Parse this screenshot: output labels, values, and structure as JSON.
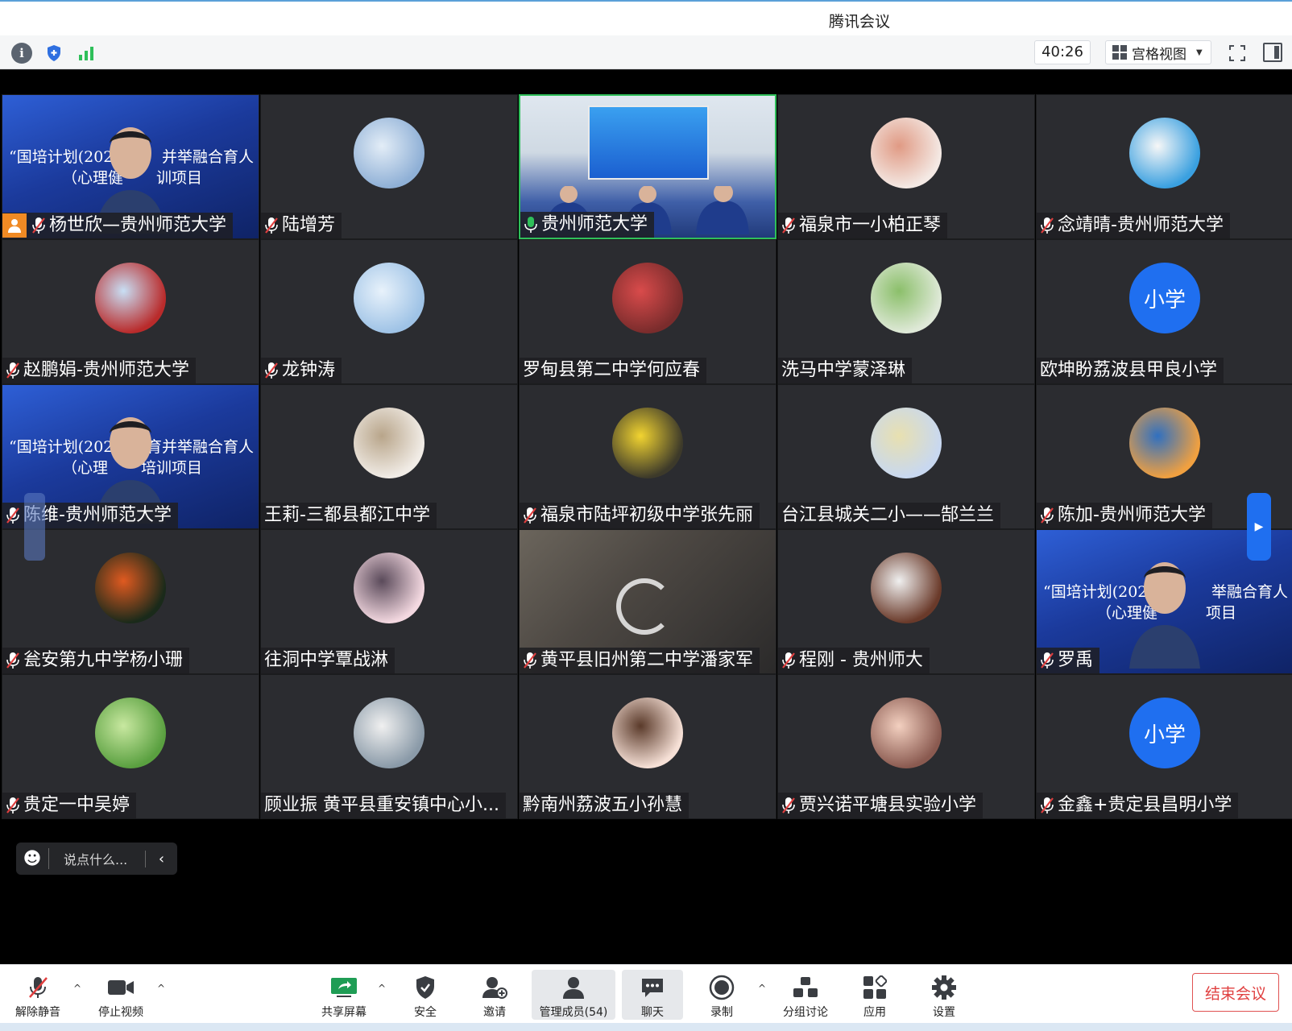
{
  "window": {
    "title": "腾讯会议"
  },
  "infobar": {
    "timer": "40:26",
    "view_label": "宫格视图"
  },
  "participants": [
    {
      "name": "杨世欣—贵州师范大学",
      "host": true,
      "muted": true,
      "kind": "video-blue",
      "slide_line1": "“国培计划(2022",
      "slide_line2": "（心理健",
      "slide_line1b": "并举融合育人",
      "slide_line2b": "训项目"
    },
    {
      "name": "陆增芳",
      "muted": true,
      "kind": "avatar"
    },
    {
      "name": "贵州师范大学",
      "muted": false,
      "speaking": true,
      "kind": "video-room",
      "active": true
    },
    {
      "name": "福泉市一小柏正琴",
      "muted": true,
      "kind": "avatar"
    },
    {
      "name": "念靖晴-贵州师范大学",
      "muted": true,
      "kind": "avatar"
    },
    {
      "name": "赵鹏娟-贵州师范大学",
      "muted": true,
      "kind": "avatar"
    },
    {
      "name": "龙钟涛",
      "muted": true,
      "kind": "avatar"
    },
    {
      "name": "罗甸县第二中学何应春",
      "muted": false,
      "kind": "avatar"
    },
    {
      "name": "洗马中学蒙泽琳",
      "muted": false,
      "kind": "avatar"
    },
    {
      "name": "欧坤盼荔波县甲良小学",
      "muted": false,
      "kind": "text-avatar",
      "avatar_text": "小学"
    },
    {
      "name": "陈维-贵州师范大学",
      "muted": true,
      "kind": "video-blue",
      "slide_line1": "“国培计划(202",
      "slide_line2": "（心理",
      "slide_line1b": "五育并举融合育人",
      "slide_line2b": "培训项目"
    },
    {
      "name": "王莉-三都县都江中学",
      "muted": false,
      "kind": "avatar"
    },
    {
      "name": "福泉市陆坪初级中学张先丽",
      "muted": true,
      "kind": "avatar"
    },
    {
      "name": "台江县城关二小——郜兰兰",
      "muted": false,
      "kind": "avatar"
    },
    {
      "name": "陈加-贵州师范大学",
      "muted": true,
      "kind": "avatar"
    },
    {
      "name": "瓮安第九中学杨小珊",
      "muted": true,
      "kind": "avatar"
    },
    {
      "name": "往洞中学覃战淋",
      "muted": false,
      "kind": "avatar"
    },
    {
      "name": "黄平县旧州第二中学潘家军",
      "muted": true,
      "kind": "video-dark"
    },
    {
      "name": "程刚 - 贵州师大",
      "muted": true,
      "kind": "avatar"
    },
    {
      "name": "罗禹",
      "muted": true,
      "kind": "video-blue",
      "slide_line1": "“国培计划(2022)",
      "slide_line2": "（心理健",
      "slide_line1b": "举融合育人",
      "slide_line2b": "项目"
    },
    {
      "name": "贵定一中吴婷",
      "muted": true,
      "kind": "avatar"
    },
    {
      "name": "顾业振  黄平县重安镇中心小...",
      "muted": false,
      "kind": "avatar"
    },
    {
      "name": "黔南州荔波五小孙慧",
      "muted": false,
      "kind": "avatar"
    },
    {
      "name": "贾兴诺平塘县实验小学",
      "muted": true,
      "kind": "avatar"
    },
    {
      "name": "金鑫+贵定县昌明小学",
      "muted": true,
      "kind": "text-avatar",
      "avatar_text": "小学"
    }
  ],
  "quick_chat": {
    "placeholder": "说点什么..."
  },
  "toolbar": {
    "unmute": "解除静音",
    "stop_video": "停止视频",
    "share_screen": "共享屏幕",
    "security": "安全",
    "invite": "邀请",
    "manage_members": "管理成员(54)",
    "chat": "聊天",
    "record": "录制",
    "breakout": "分组讨论",
    "apps": "应用",
    "settings": "设置",
    "end_meeting": "结束会议"
  },
  "colors": {
    "accent": "#1f6ff0",
    "speaking": "#2fbf5a",
    "end": "#e04040",
    "host": "#f08a24"
  }
}
